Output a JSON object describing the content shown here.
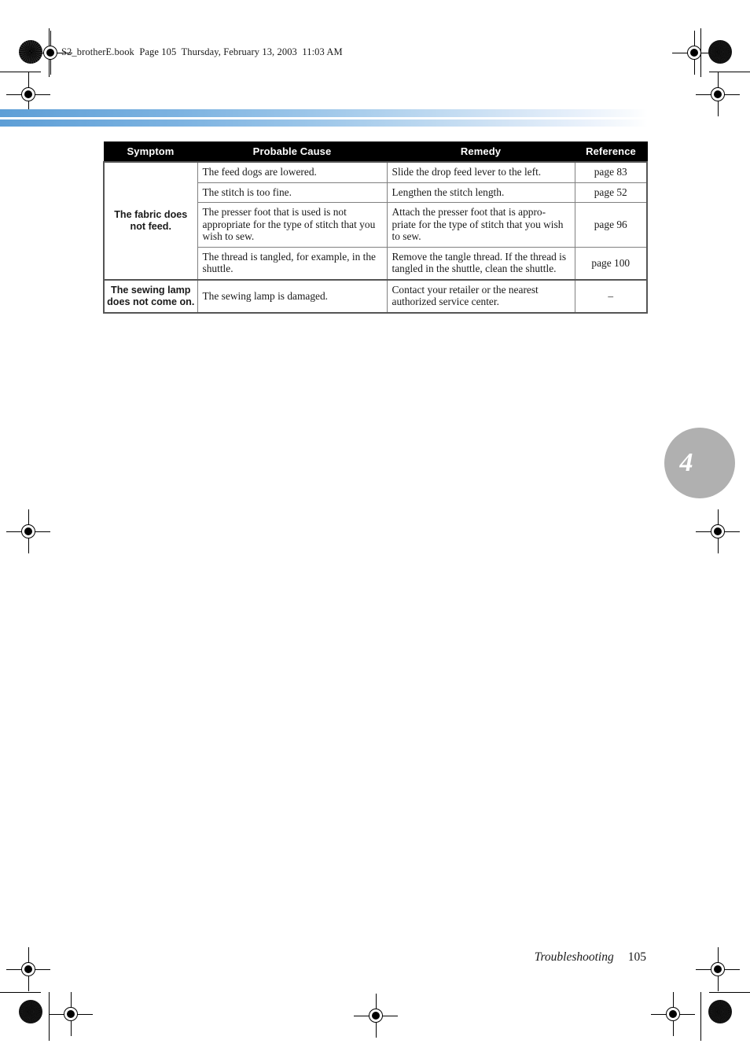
{
  "page": {
    "book_header": "S2_brotherE.book  Page 105  Thursday, February 13, 2003  11:03 AM",
    "chapter_marker": "4",
    "footer_chapter": "Troubleshooting",
    "footer_page": "105",
    "accent_color": "#6aa7da",
    "header_bg": "#000000",
    "chapter_bubble_color": "#b0b0b0"
  },
  "table": {
    "columns": [
      {
        "key": "symptom",
        "label": "Symptom"
      },
      {
        "key": "cause",
        "label": "Probable Cause"
      },
      {
        "key": "remedy",
        "label": "Remedy"
      },
      {
        "key": "reference",
        "label": "Reference"
      }
    ],
    "rows": [
      {
        "symptom": "The fabric does not feed.",
        "symptom_line1": "The fabric does",
        "symptom_line2": "not feed.",
        "cause": "The feed dogs are lowered.",
        "remedy": "Slide the drop feed lever to the left.",
        "reference": "page 83"
      },
      {
        "cause": "The stitch is too fine.",
        "remedy": "Lengthen the stitch length.",
        "reference": "page 52"
      },
      {
        "cause": "The presser foot that is used is not appropriate for the type of stitch that you wish to sew.",
        "remedy": "Attach the presser foot that is appro-priate for the type of stitch that you wish to sew.",
        "reference": "page 96"
      },
      {
        "cause": "The thread is tangled, for example, in the shuttle.",
        "remedy": "Remove the tangle thread. If the thread is tangled in the shuttle, clean the shuttle.",
        "reference": "page 100"
      },
      {
        "symptom": "The sewing lamp does not come on.",
        "symptom_line1": "The sewing lamp",
        "symptom_line2": "does not come on.",
        "cause": "The sewing lamp is damaged.",
        "remedy": "Contact your retailer or the nearest authorized service center.",
        "reference": "–"
      }
    ]
  }
}
